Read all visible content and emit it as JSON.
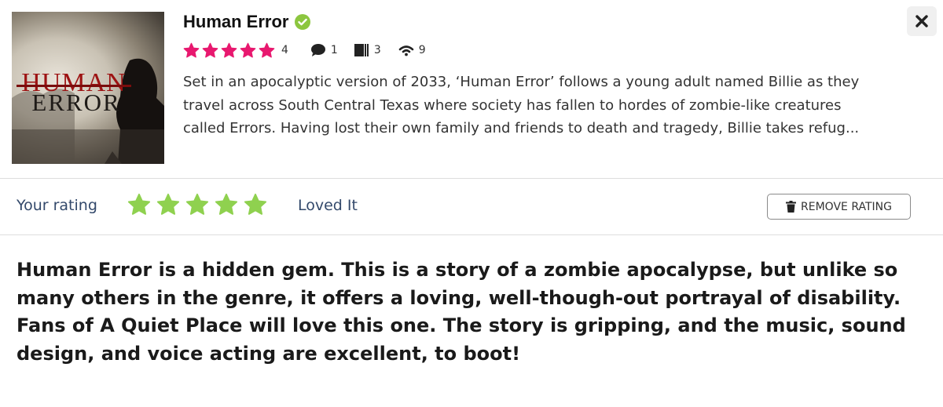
{
  "item": {
    "title": "Human Error",
    "cover_title": "HUMAN",
    "cover_subtitle": "ERROR",
    "star_count": 5,
    "rating_count": "4",
    "comments": "1",
    "episodes": "3",
    "listens": "9",
    "description_lines": [
      "Set in an apocalyptic version of 2033, ‘Human Error’ follows a young adult named Billie as they",
      "travel across South Central Texas where society has fallen to hordes of zombie-like creatures",
      "called Errors. Having lost their own family and friends to death and tragedy, Billie takes refug..."
    ]
  },
  "icons": {
    "verified": "check-circle-icon",
    "close": "close-icon",
    "comment": "comment-icon",
    "episodes": "book-icon",
    "listens": "wifi-icon",
    "trash": "trash-icon"
  },
  "user_rating": {
    "label": "Your rating",
    "stars": 5,
    "verdict": "Loved It",
    "remove_label": "REMOVE RATING"
  },
  "review": {
    "lines": [
      "Human Error is a hidden gem. This is a story of a zombie apocalypse, but unlike so",
      "many others in the genre, it offers a loving, well-though-out portrayal of disability.",
      "Fans of A Quiet Place will love this one. The story is gripping, and the music, sound",
      "design, and voice acting are excellent, to boot!"
    ]
  },
  "colors": {
    "pink_star": "#e8186f",
    "green_star": "#8fd14f",
    "verified_green": "#8cc63f",
    "label_blue": "#33496b"
  }
}
